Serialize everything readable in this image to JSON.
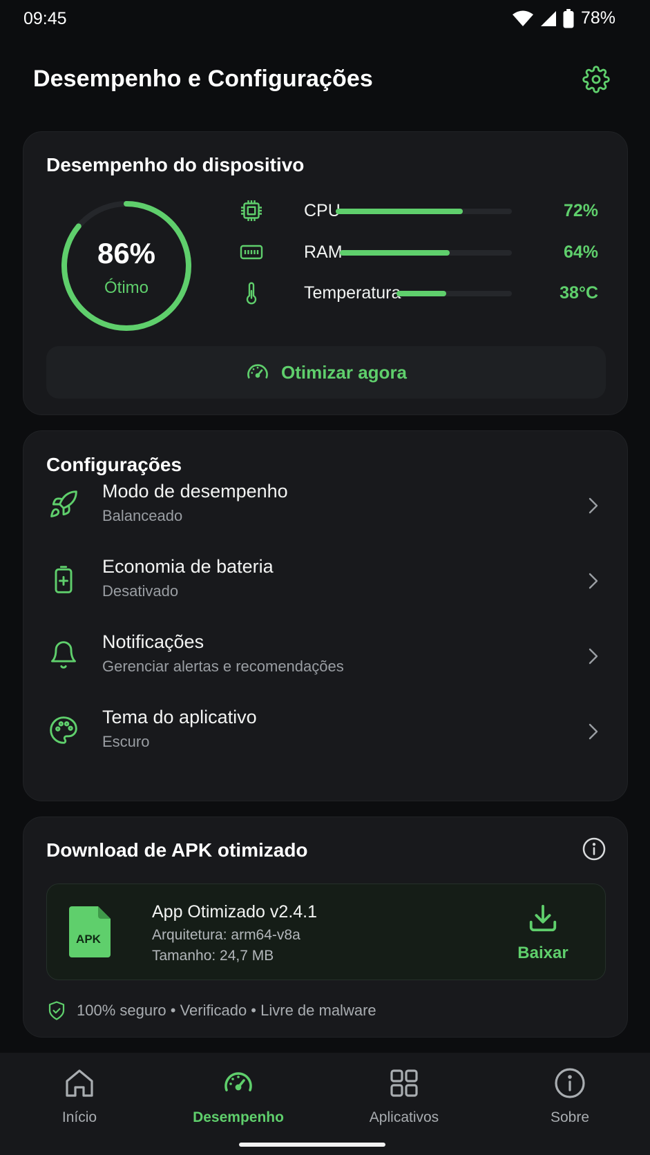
{
  "colors": {
    "accent": "#5fcf6c",
    "background": "#0c0d0f",
    "card": "#18191c"
  },
  "status_bar": {
    "time": "09:45",
    "battery": "78%",
    "icons": [
      "wifi-icon",
      "signal-icon",
      "battery-icon"
    ]
  },
  "header": {
    "title": "Desempenho e Configurações",
    "settings_icon": "gear-icon"
  },
  "performance": {
    "title": "Desempenho do dispositivo",
    "score": {
      "value": "86%",
      "label": "Ótimo",
      "fraction": 0.86
    },
    "metrics": [
      {
        "icon": "cpu-icon",
        "label": "CPU",
        "value": "72%",
        "fraction": 0.72
      },
      {
        "icon": "memory-icon",
        "label": "RAM",
        "value": "64%",
        "fraction": 0.64
      },
      {
        "icon": "thermometer-icon",
        "label": "Temperatura",
        "value": "38°C",
        "fraction": 0.43
      }
    ],
    "optimize_button": {
      "icon": "speedometer-icon",
      "label": "Otimizar agora"
    }
  },
  "settings": {
    "title": "Configurações",
    "items": [
      {
        "icon": "rocket-icon",
        "title": "Modo de desempenho",
        "subtitle": "Balanceado"
      },
      {
        "icon": "battery-plus-icon",
        "title": "Economia de bateria",
        "subtitle": "Desativado"
      },
      {
        "icon": "bell-icon",
        "title": "Notificações",
        "subtitle": "Gerenciar alertas e recomendações"
      },
      {
        "icon": "palette-icon",
        "title": "Tema do aplicativo",
        "subtitle": "Escuro"
      }
    ]
  },
  "apk": {
    "title": "Download de APK otimizado",
    "info_icon": "info-icon",
    "file_badge": "APK",
    "name": "App Otimizado v2.4.1",
    "architecture": "Arquitetura: arm64-v8a",
    "size": "Tamanho: 24,7 MB",
    "download_label": "Baixar",
    "secure_text": "100% seguro • Verificado • Livre de malware"
  },
  "bottom_nav": {
    "items": [
      {
        "icon": "home-icon",
        "label": "Início",
        "active": false
      },
      {
        "icon": "speedometer-icon",
        "label": "Desempenho",
        "active": true
      },
      {
        "icon": "grid-icon",
        "label": "Aplicativos",
        "active": false
      },
      {
        "icon": "info-icon",
        "label": "Sobre",
        "active": false
      }
    ]
  }
}
